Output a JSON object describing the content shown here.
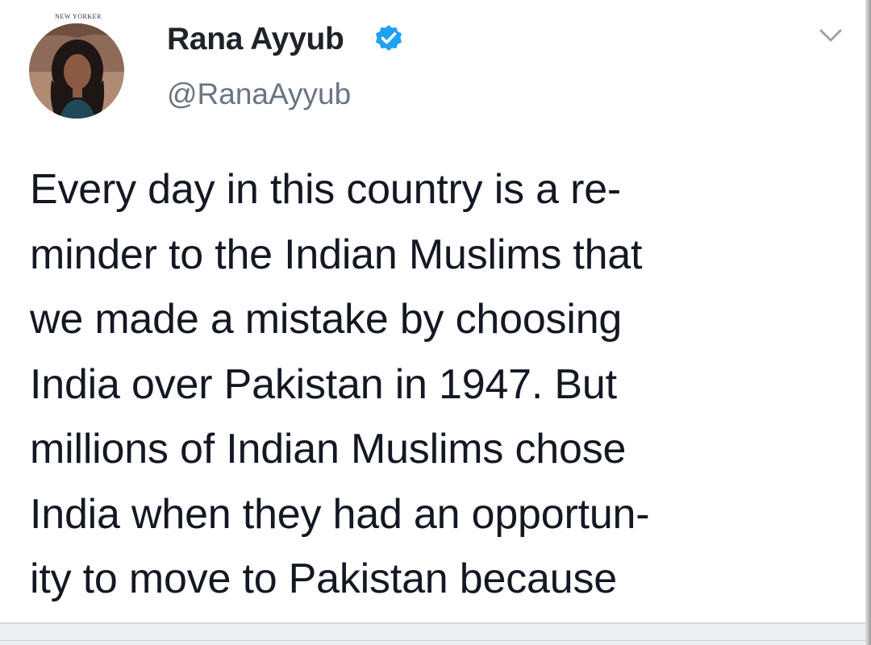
{
  "profile": {
    "avatar_caption": "NEW YORKER",
    "name": "Rana Ayyub",
    "handle": "@RanaAyyub",
    "verified": true
  },
  "tweet": {
    "lines": [
      "Every day in this country is a re-",
      "minder to the Indian Muslims that",
      "we made a mistake by choosing",
      "India over Pakistan in 1947. But",
      "millions of Indian Muslims chose",
      "India when they had an opportun-",
      "ity to move to Pakistan because"
    ]
  },
  "icons": {
    "verified": "verified-badge-icon",
    "menu": "chevron-down-icon"
  },
  "colors": {
    "verified_blue": "#1da1f2",
    "handle_gray": "#6b7480",
    "text": "#141823"
  }
}
